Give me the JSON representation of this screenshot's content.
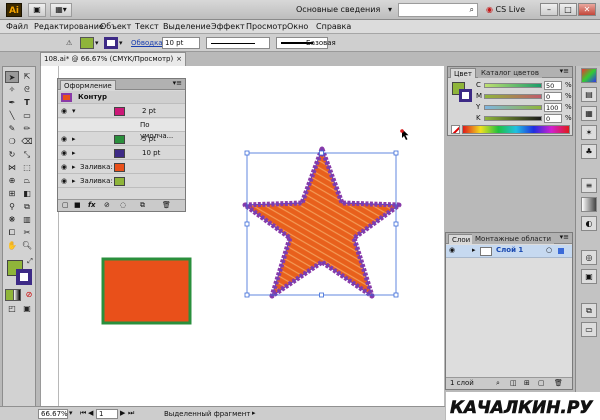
{
  "title_bar": {
    "app_logo": "Ai",
    "workspace_label": "Основные сведения",
    "cs_live_label": "CS Live",
    "window_controls": [
      "minimize-icon",
      "maximize-icon",
      "close-icon"
    ]
  },
  "menu": {
    "items": [
      "Файл",
      "Редактирование",
      "Объект",
      "Текст",
      "Выделение",
      "Эффект",
      "Просмотр",
      "Окно",
      "Справка"
    ]
  },
  "control_bar": {
    "fill_color": "#8fb53a",
    "stroke_color": "#3d2a86",
    "stroke_label": "Обводка:",
    "stroke_weight": "10 pt",
    "profile_label": "Базовая"
  },
  "document": {
    "tab_title": "108.ai* @ 66.67% (CMYK/Просмотр)",
    "close_icon": "×"
  },
  "appearance_panel": {
    "tabs": [
      "Оформление"
    ],
    "header_label": "Контур",
    "rows": [
      {
        "label": "2 pt",
        "color": "#cc1877",
        "has_arrow": true
      },
      {
        "label": "По умолча...",
        "color": "",
        "has_arrow": false
      },
      {
        "label": "5 pt",
        "color": "#2a8f3c",
        "has_arrow": true
      },
      {
        "label": "10 pt",
        "color": "#3d2a86",
        "has_arrow": true
      },
      {
        "label": "Заливка:",
        "color": "#e9501a",
        "has_arrow": true
      },
      {
        "label": "Заливка:",
        "color": "#8fb53a",
        "has_arrow": true
      }
    ]
  },
  "color_panel": {
    "tabs": [
      "Цвет",
      "Каталог цветов"
    ],
    "channels": [
      {
        "label": "C",
        "value": "50",
        "unit": "%",
        "level": 0.5,
        "color": "#00a4e0"
      },
      {
        "label": "M",
        "value": "0",
        "unit": "%",
        "level": 0.0,
        "color": "#e2007a"
      },
      {
        "label": "Y",
        "value": "100",
        "unit": "%",
        "level": 1.0,
        "color": "#f5e000"
      },
      {
        "label": "K",
        "value": "0",
        "unit": "%",
        "level": 0.0,
        "color": "#111111"
      }
    ]
  },
  "layers_panel": {
    "tabs": [
      "Слои",
      "Монтажные области"
    ],
    "layer_name": "Слой 1",
    "layer_count": "1 слой"
  },
  "status_bar": {
    "zoom": "66.67%",
    "page": "1",
    "selection_label": "Выделенный фрагмент"
  },
  "artwork": {
    "square_fill": "#e9501a",
    "square_stroke": "#2a8f3c",
    "star_fill": "#e8601c",
    "star_stroke": "#8a3aa8"
  },
  "watermark": {
    "text": "КАЧАЛКИН.РУ"
  }
}
